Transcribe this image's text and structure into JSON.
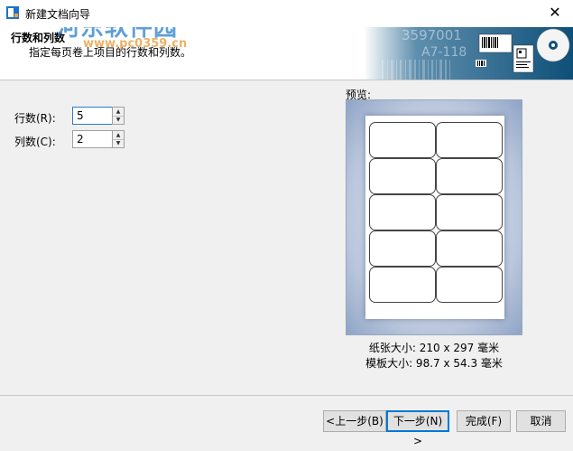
{
  "window": {
    "title": "新建文档向导",
    "close_glyph": "✕"
  },
  "watermark": {
    "site_name": "河东软件园",
    "url_fragment": "www.pc0359.cn"
  },
  "banner": {
    "barcode_text_1": "3597001",
    "barcode_text_2": "A7-118"
  },
  "header": {
    "title": "行数和列数",
    "subtitle": "指定每页卷上项目的行数和列数。"
  },
  "form": {
    "rows_label": "行数(R):",
    "rows_value": "5",
    "cols_label": "列数(C):",
    "cols_value": "2"
  },
  "preview": {
    "label": "预览:",
    "rows": 5,
    "cols": 2,
    "paper_size": "纸张大小: 210 x 297 毫米",
    "template_size": "模板大小: 98.7 x 54.3 毫米"
  },
  "buttons": {
    "back": "<上一步(B)",
    "next": "下一步(N) >",
    "finish": "完成(F)",
    "cancel": "取消"
  },
  "colors": {
    "accent": "#0078d7",
    "watermark": "#2a7fc9"
  }
}
